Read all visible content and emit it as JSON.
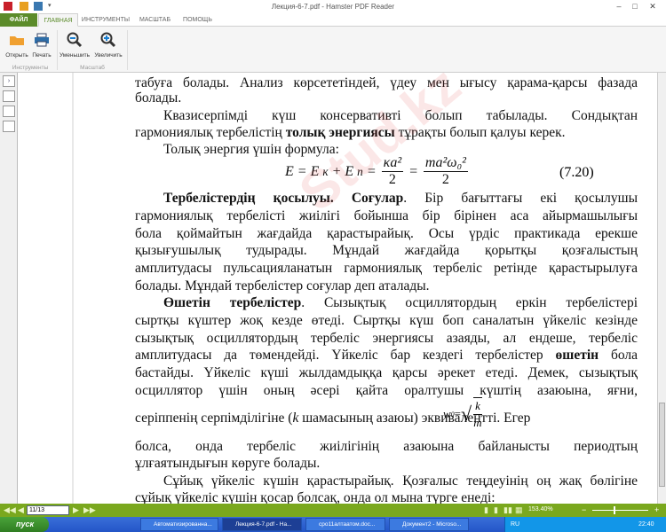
{
  "window": {
    "title": "Лекция-6-7.pdf - Hamster PDF Reader",
    "minimize": "–",
    "maximize": "□",
    "close": "✕",
    "qat_more": "▾"
  },
  "tabs": [
    {
      "label": "ФАЙЛ"
    },
    {
      "label": "ГЛАВНАЯ"
    },
    {
      "label": "ИНСТРУМЕНТЫ"
    },
    {
      "label": "МАСШТАБ"
    },
    {
      "label": "ПОМОЩЬ"
    }
  ],
  "ribbon": {
    "open": "Открыть",
    "print": "Печать",
    "zoom_out": "Уменьшить",
    "zoom_in": "Увеличить",
    "group_tools": "Инструменты",
    "group_zoom": "Масштаб"
  },
  "sidebar": {
    "toggle": "›"
  },
  "document": {
    "lines": [
      {
        "segments": [
          {
            "t": "табуға болады. Анализ көрсететіндей, үдеу мен ығысу қарама-қарсы фазада"
          }
        ],
        "justify": true
      },
      {
        "segments": [
          {
            "t": "болады."
          }
        ],
        "justify": false
      },
      {
        "segments": [
          {
            "t": "Квазисерпімді күш консервативті болып табылады. Сондықтан"
          }
        ],
        "justify": true,
        "indent": true
      },
      {
        "segments": [
          {
            "t": "гармониялық тербелістің "
          },
          {
            "t": "толық энергиясы",
            "b": true
          },
          {
            "t": " тұрақты болып қалуы керек."
          }
        ],
        "justify": false
      },
      {
        "segments": [
          {
            "t": "Толық энергия үшін формула:"
          }
        ],
        "justify": false,
        "indent": true
      },
      {
        "segments": [
          {
            "t": "Тербелістердің қосылуы. Соғулар",
            "b": true
          },
          {
            "t": ". Бір бағыттағы екі қосылушы"
          }
        ],
        "justify": true,
        "indent": true
      },
      {
        "segments": [
          {
            "t": "гармониялық тербелісті жиілігі бойынша бір бірінен аса айырмашылығы"
          }
        ],
        "justify": true
      },
      {
        "segments": [
          {
            "t": "бола қоймайтын жағдайда қарастырайық. Осы үрдіс практикада ерекше"
          }
        ],
        "justify": true
      },
      {
        "segments": [
          {
            "t": "қызығушылық тудырады. Мұндай жағдайда қорытқы қозғалыстың"
          }
        ],
        "justify": true
      },
      {
        "segments": [
          {
            "t": "амплитудасы пульсацияланатын гармониялық тербеліс ретінде қарастырылуға"
          }
        ],
        "justify": true
      },
      {
        "segments": [
          {
            "t": "болады. Мұндай тербелістер соғулар деп аталады."
          }
        ],
        "justify": false
      },
      {
        "segments": [
          {
            "t": "Өшетін тербелістер",
            "b": true
          },
          {
            "t": ". Сызықтық осциллятордың еркін тербелістері"
          }
        ],
        "justify": true,
        "indent": true
      },
      {
        "segments": [
          {
            "t": "сыртқы күштер жоқ кезде өтеді. Сыртқы күш боп саналатын үйкеліс кезінде"
          }
        ],
        "justify": true
      },
      {
        "segments": [
          {
            "t": "сызықтық осциллятордың тербеліс энергиясы азаяды, ал ендеше, тербеліс"
          }
        ],
        "justify": true
      },
      {
        "segments": [
          {
            "t": "амплитудасы да төмендейді. Үйкеліс бар кездегі тербелістер "
          },
          {
            "t": "өшетін",
            "b": true
          },
          {
            "t": " бола"
          }
        ],
        "justify": true
      },
      {
        "segments": [
          {
            "t": "бастайды. Үйкеліс күші жылдамдыққа қарсы әрекет етеді. Демек, сызықтық"
          }
        ],
        "justify": true
      },
      {
        "segments": [
          {
            "t": "осциллятор үшін оның әсері қайта оралтушы күштің азаюына, яғни,"
          }
        ],
        "justify": true
      },
      {
        "segments": [
          {
            "t": "серіппенің серпімділігіне ("
          },
          {
            "t": "k",
            "i": true
          },
          {
            "t": " шамасының азаюы) эквивалентті. Егер"
          }
        ],
        "justify": false
      },
      {
        "segments": [
          {
            "t": "болса, онда тербеліс жиілігінің азаюына байланысты периодтың"
          }
        ],
        "justify": true
      },
      {
        "segments": [
          {
            "t": "ұлғаятындығын көруге болады."
          }
        ],
        "justify": false
      },
      {
        "segments": [
          {
            "t": "Сұйық үйкеліс күшін қарастырайық. Қозғалыс теңдеуінің оң жақ бөлігіне"
          }
        ],
        "justify": true,
        "indent": true
      },
      {
        "segments": [
          {
            "t": "сұйық үйкеліс күшін қосар болсақ, онда ол мына түрге енеді:"
          }
        ],
        "justify": false
      }
    ],
    "formula": {
      "lhs": "E = E",
      "sub_k": "к",
      "plus": " + E",
      "sub_p": "п",
      "eq": " =",
      "num1": "κa²",
      "den1": "2",
      "eq2": "=",
      "num2": "ma²ω₀²",
      "den2": "2",
      "number": "(7.20)"
    },
    "w0": {
      "lhs": "w",
      "sub": "0",
      "eq": "=",
      "num": "k",
      "den": "m"
    }
  },
  "statusbar": {
    "page": "11/13",
    "zoom": "153.40%",
    "zoom_minus": "−",
    "zoom_plus": "+"
  },
  "taskbar": {
    "start": "пуск",
    "tasks": [
      "Автоматизированна...",
      "Лекция-6-7.pdf - На...",
      "сро11алтаатом.doc...",
      "Документ2 - Microso..."
    ],
    "lang": "RU",
    "time": "22:40"
  }
}
